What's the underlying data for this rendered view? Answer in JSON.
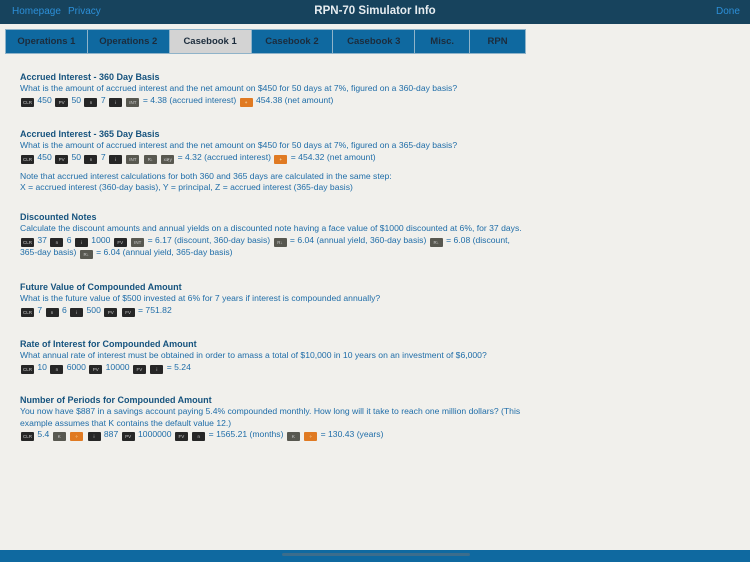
{
  "header": {
    "homepage": "Homepage",
    "privacy": "Privacy",
    "title": "RPN-70 Simulator Info",
    "done": "Done"
  },
  "tabs": [
    {
      "label": "Operations 1"
    },
    {
      "label": "Operations 2"
    },
    {
      "label": "Casebook 1",
      "active": true
    },
    {
      "label": "Casebook 2"
    },
    {
      "label": "Casebook 3"
    },
    {
      "label": "Misc."
    },
    {
      "label": "RPN"
    }
  ],
  "sections": [
    {
      "title": "Accrued Interest - 360 Day Basis",
      "question": "What is the amount of accrued interest and the net amount on $450 for 50 days at 7%, figured on a 360-day basis?",
      "steps": [
        {
          "k": "CLR",
          "c": "dark"
        },
        {
          "t": "450"
        },
        {
          "k": "PV",
          "c": "dark"
        },
        {
          "t": "50"
        },
        {
          "k": "n",
          "c": "dark"
        },
        {
          "t": "7"
        },
        {
          "k": "i",
          "c": "dark"
        },
        {
          "k": "INT",
          "c": "gray"
        },
        {
          "t": "= 4.38 (accrued interest)"
        },
        {
          "k": "+",
          "c": "orange"
        },
        {
          "t": "454.38 (net amount)"
        }
      ]
    },
    {
      "title": "Accrued Interest - 365 Day Basis",
      "question": "What is the amount of accrued interest and the net amount on $450 for 50 days at 7%, figured on a 365-day basis?",
      "steps": [
        {
          "k": "CLR",
          "c": "dark"
        },
        {
          "t": "450"
        },
        {
          "k": "PV",
          "c": "dark"
        },
        {
          "t": "50"
        },
        {
          "k": "n",
          "c": "dark"
        },
        {
          "t": "7"
        },
        {
          "k": "i",
          "c": "dark"
        },
        {
          "k": "INT",
          "c": "gray"
        },
        {
          "k": "R↓",
          "c": "gray"
        },
        {
          "k": "x≷y",
          "c": "gray"
        },
        {
          "t": "= 4.32 (accrued interest)"
        },
        {
          "k": "+",
          "c": "orange"
        },
        {
          "t": "= 454.32 (net amount)"
        }
      ],
      "note": [
        "Note that accrued interest calculations for both 360 and 365 days are calculated in the same step:",
        "X = accrued interest (360-day basis), Y = principal, Z = accrued interest (365-day basis)"
      ]
    },
    {
      "title": "Discounted Notes",
      "question": "Calculate the discount amounts and annual yields on a discounted note having a face value of $1000 discounted at 6%, for 37 days.",
      "steps": [
        {
          "k": "CLR",
          "c": "dark"
        },
        {
          "t": "37"
        },
        {
          "k": "n",
          "c": "dark"
        },
        {
          "t": "6"
        },
        {
          "k": "i",
          "c": "dark"
        },
        {
          "t": "1000"
        },
        {
          "k": "FV",
          "c": "dark"
        },
        {
          "k": "INT",
          "c": "gray"
        },
        {
          "t": "= 6.17 (discount, 360-day basis)"
        },
        {
          "k": "R↓",
          "c": "gray"
        },
        {
          "t": "= 6.04 (annual yield, 360-day basis)"
        },
        {
          "k": "R↓",
          "c": "gray"
        },
        {
          "t": "= 6.08 (discount, 365-day basis)"
        },
        {
          "k": "R↓",
          "c": "gray"
        },
        {
          "t": "= 6.04 (annual yield, 365-day basis)"
        }
      ]
    },
    {
      "title": "Future Value of Compounded Amount",
      "question": "What is the future value of $500 invested at 6% for 7 years if interest is compounded annually?",
      "steps": [
        {
          "k": "CLR",
          "c": "dark"
        },
        {
          "t": "7"
        },
        {
          "k": "n",
          "c": "dark"
        },
        {
          "t": "6"
        },
        {
          "k": "i",
          "c": "dark"
        },
        {
          "t": "500"
        },
        {
          "k": "PV",
          "c": "dark"
        },
        {
          "k": "FV",
          "c": "dark"
        },
        {
          "t": "= 751.82"
        }
      ]
    },
    {
      "title": "Rate of Interest for Compounded Amount",
      "question": "What annual rate of interest must be obtained in order to amass a total of $10,000 in 10 years on an investment of $6,000?",
      "steps": [
        {
          "k": "CLR",
          "c": "dark"
        },
        {
          "t": "10"
        },
        {
          "k": "n",
          "c": "dark"
        },
        {
          "t": "6000"
        },
        {
          "k": "PV",
          "c": "dark"
        },
        {
          "t": "10000"
        },
        {
          "k": "FV",
          "c": "dark"
        },
        {
          "k": "i",
          "c": "dark"
        },
        {
          "t": "= 5.24"
        }
      ]
    },
    {
      "title": "Number of Periods for Compounded Amount",
      "question": "You now have $887 in a savings account paying 5.4% compounded monthly. How long will it take to reach one million dollars? (This example assumes that K contains the default value 12.)",
      "steps": [
        {
          "k": "CLR",
          "c": "dark"
        },
        {
          "t": "5.4"
        },
        {
          "k": "K",
          "c": "gray"
        },
        {
          "k": "÷",
          "c": "orange"
        },
        {
          "k": "i",
          "c": "dark"
        },
        {
          "t": "887"
        },
        {
          "k": "PV",
          "c": "dark"
        },
        {
          "t": "1000000"
        },
        {
          "k": "FV",
          "c": "dark"
        },
        {
          "k": "n",
          "c": "dark"
        },
        {
          "t": "= 1565.21 (months)"
        },
        {
          "k": "K",
          "c": "gray"
        },
        {
          "k": "÷",
          "c": "orange"
        },
        {
          "t": "= 130.43 (years)"
        }
      ]
    }
  ]
}
